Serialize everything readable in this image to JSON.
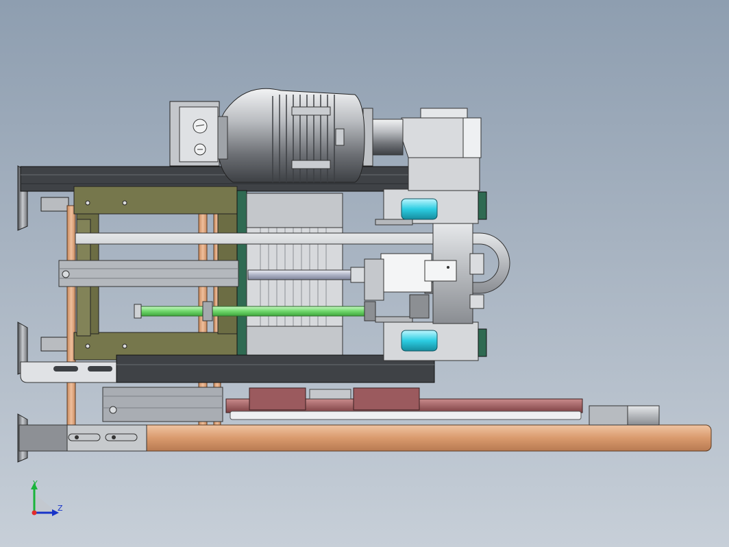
{
  "viewport": {
    "background_top": "#8e9eb0",
    "background_bottom": "#c7cfd8"
  },
  "model": {
    "parts": [
      "gear-motor",
      "gearbox",
      "roller-frame",
      "cable-chain",
      "linear-rail",
      "base-beam",
      "leveling-feet",
      "drive-shafts",
      "rollers"
    ],
    "colors": {
      "steel_dark": "#3f4246",
      "steel_light": "#c9ccd0",
      "olive_frame": "#6f7048",
      "copper_profile": "#d8a07a",
      "cyan_roller": "#35d2e6",
      "green_shaft": "#7ce37a",
      "rail_red": "#9b5a5e",
      "panel_green": "#2f6a52"
    }
  },
  "triad": {
    "y_label": "Y",
    "z_label": "Z",
    "y_color": "#19b43a",
    "z_color": "#1733c8"
  }
}
